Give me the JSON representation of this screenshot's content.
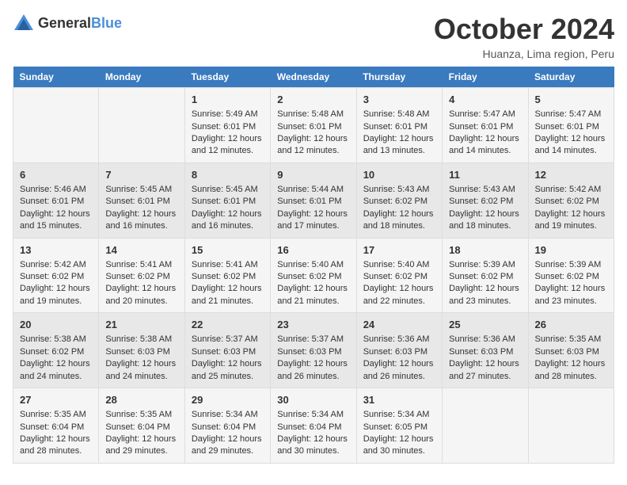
{
  "logo": {
    "general": "General",
    "blue": "Blue"
  },
  "title": "October 2024",
  "location": "Huanza, Lima region, Peru",
  "headers": [
    "Sunday",
    "Monday",
    "Tuesday",
    "Wednesday",
    "Thursday",
    "Friday",
    "Saturday"
  ],
  "weeks": [
    [
      {
        "day": "",
        "sunrise": "",
        "sunset": "",
        "daylight": ""
      },
      {
        "day": "",
        "sunrise": "",
        "sunset": "",
        "daylight": ""
      },
      {
        "day": "1",
        "sunrise": "Sunrise: 5:49 AM",
        "sunset": "Sunset: 6:01 PM",
        "daylight": "Daylight: 12 hours and 12 minutes."
      },
      {
        "day": "2",
        "sunrise": "Sunrise: 5:48 AM",
        "sunset": "Sunset: 6:01 PM",
        "daylight": "Daylight: 12 hours and 12 minutes."
      },
      {
        "day": "3",
        "sunrise": "Sunrise: 5:48 AM",
        "sunset": "Sunset: 6:01 PM",
        "daylight": "Daylight: 12 hours and 13 minutes."
      },
      {
        "day": "4",
        "sunrise": "Sunrise: 5:47 AM",
        "sunset": "Sunset: 6:01 PM",
        "daylight": "Daylight: 12 hours and 14 minutes."
      },
      {
        "day": "5",
        "sunrise": "Sunrise: 5:47 AM",
        "sunset": "Sunset: 6:01 PM",
        "daylight": "Daylight: 12 hours and 14 minutes."
      }
    ],
    [
      {
        "day": "6",
        "sunrise": "Sunrise: 5:46 AM",
        "sunset": "Sunset: 6:01 PM",
        "daylight": "Daylight: 12 hours and 15 minutes."
      },
      {
        "day": "7",
        "sunrise": "Sunrise: 5:45 AM",
        "sunset": "Sunset: 6:01 PM",
        "daylight": "Daylight: 12 hours and 16 minutes."
      },
      {
        "day": "8",
        "sunrise": "Sunrise: 5:45 AM",
        "sunset": "Sunset: 6:01 PM",
        "daylight": "Daylight: 12 hours and 16 minutes."
      },
      {
        "day": "9",
        "sunrise": "Sunrise: 5:44 AM",
        "sunset": "Sunset: 6:01 PM",
        "daylight": "Daylight: 12 hours and 17 minutes."
      },
      {
        "day": "10",
        "sunrise": "Sunrise: 5:43 AM",
        "sunset": "Sunset: 6:02 PM",
        "daylight": "Daylight: 12 hours and 18 minutes."
      },
      {
        "day": "11",
        "sunrise": "Sunrise: 5:43 AM",
        "sunset": "Sunset: 6:02 PM",
        "daylight": "Daylight: 12 hours and 18 minutes."
      },
      {
        "day": "12",
        "sunrise": "Sunrise: 5:42 AM",
        "sunset": "Sunset: 6:02 PM",
        "daylight": "Daylight: 12 hours and 19 minutes."
      }
    ],
    [
      {
        "day": "13",
        "sunrise": "Sunrise: 5:42 AM",
        "sunset": "Sunset: 6:02 PM",
        "daylight": "Daylight: 12 hours and 19 minutes."
      },
      {
        "day": "14",
        "sunrise": "Sunrise: 5:41 AM",
        "sunset": "Sunset: 6:02 PM",
        "daylight": "Daylight: 12 hours and 20 minutes."
      },
      {
        "day": "15",
        "sunrise": "Sunrise: 5:41 AM",
        "sunset": "Sunset: 6:02 PM",
        "daylight": "Daylight: 12 hours and 21 minutes."
      },
      {
        "day": "16",
        "sunrise": "Sunrise: 5:40 AM",
        "sunset": "Sunset: 6:02 PM",
        "daylight": "Daylight: 12 hours and 21 minutes."
      },
      {
        "day": "17",
        "sunrise": "Sunrise: 5:40 AM",
        "sunset": "Sunset: 6:02 PM",
        "daylight": "Daylight: 12 hours and 22 minutes."
      },
      {
        "day": "18",
        "sunrise": "Sunrise: 5:39 AM",
        "sunset": "Sunset: 6:02 PM",
        "daylight": "Daylight: 12 hours and 23 minutes."
      },
      {
        "day": "19",
        "sunrise": "Sunrise: 5:39 AM",
        "sunset": "Sunset: 6:02 PM",
        "daylight": "Daylight: 12 hours and 23 minutes."
      }
    ],
    [
      {
        "day": "20",
        "sunrise": "Sunrise: 5:38 AM",
        "sunset": "Sunset: 6:02 PM",
        "daylight": "Daylight: 12 hours and 24 minutes."
      },
      {
        "day": "21",
        "sunrise": "Sunrise: 5:38 AM",
        "sunset": "Sunset: 6:03 PM",
        "daylight": "Daylight: 12 hours and 24 minutes."
      },
      {
        "day": "22",
        "sunrise": "Sunrise: 5:37 AM",
        "sunset": "Sunset: 6:03 PM",
        "daylight": "Daylight: 12 hours and 25 minutes."
      },
      {
        "day": "23",
        "sunrise": "Sunrise: 5:37 AM",
        "sunset": "Sunset: 6:03 PM",
        "daylight": "Daylight: 12 hours and 26 minutes."
      },
      {
        "day": "24",
        "sunrise": "Sunrise: 5:36 AM",
        "sunset": "Sunset: 6:03 PM",
        "daylight": "Daylight: 12 hours and 26 minutes."
      },
      {
        "day": "25",
        "sunrise": "Sunrise: 5:36 AM",
        "sunset": "Sunset: 6:03 PM",
        "daylight": "Daylight: 12 hours and 27 minutes."
      },
      {
        "day": "26",
        "sunrise": "Sunrise: 5:35 AM",
        "sunset": "Sunset: 6:03 PM",
        "daylight": "Daylight: 12 hours and 28 minutes."
      }
    ],
    [
      {
        "day": "27",
        "sunrise": "Sunrise: 5:35 AM",
        "sunset": "Sunset: 6:04 PM",
        "daylight": "Daylight: 12 hours and 28 minutes."
      },
      {
        "day": "28",
        "sunrise": "Sunrise: 5:35 AM",
        "sunset": "Sunset: 6:04 PM",
        "daylight": "Daylight: 12 hours and 29 minutes."
      },
      {
        "day": "29",
        "sunrise": "Sunrise: 5:34 AM",
        "sunset": "Sunset: 6:04 PM",
        "daylight": "Daylight: 12 hours and 29 minutes."
      },
      {
        "day": "30",
        "sunrise": "Sunrise: 5:34 AM",
        "sunset": "Sunset: 6:04 PM",
        "daylight": "Daylight: 12 hours and 30 minutes."
      },
      {
        "day": "31",
        "sunrise": "Sunrise: 5:34 AM",
        "sunset": "Sunset: 6:05 PM",
        "daylight": "Daylight: 12 hours and 30 minutes."
      },
      {
        "day": "",
        "sunrise": "",
        "sunset": "",
        "daylight": ""
      },
      {
        "day": "",
        "sunrise": "",
        "sunset": "",
        "daylight": ""
      }
    ]
  ]
}
